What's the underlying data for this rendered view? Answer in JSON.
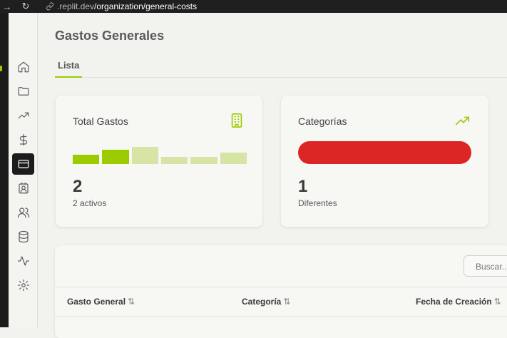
{
  "browser": {
    "url_host": ".replit.dev",
    "url_path": "/organization/general-costs",
    "forward_icon": "→",
    "reload_icon": "↻"
  },
  "sidebar": {
    "items": [
      {
        "name": "home-icon",
        "active": false
      },
      {
        "name": "folder-icon",
        "active": false
      },
      {
        "name": "trending-up-icon",
        "active": false
      },
      {
        "name": "dollar-icon",
        "active": false
      },
      {
        "name": "credit-card-icon",
        "active": true
      },
      {
        "name": "contact-badge-icon",
        "active": false
      },
      {
        "name": "users-icon",
        "active": false
      },
      {
        "name": "database-icon",
        "active": false
      },
      {
        "name": "activity-icon",
        "active": false
      },
      {
        "name": "settings-icon",
        "active": false
      }
    ]
  },
  "page": {
    "title": "Gastos Generales",
    "tabs": [
      "Lista"
    ]
  },
  "cards": {
    "total": {
      "label": "Total Gastos",
      "value": "2",
      "sub": "2 activos",
      "icon": "building-icon",
      "bar_levels": [
        0.55,
        0.85,
        1.0,
        0.4,
        0.4,
        0.65
      ],
      "bar_colors": [
        "#9ccc00",
        "#9ccc00",
        "#d6e4a6",
        "#d6e4a6",
        "#d6e4a6",
        "#d6e4a6"
      ]
    },
    "categories": {
      "label": "Categorías",
      "value": "1",
      "sub": "Diferentes",
      "icon": "trending-up-icon",
      "bar_color": "#dc2626"
    }
  },
  "table": {
    "search_placeholder": "Buscar...",
    "columns": [
      "Gasto General",
      "Categoría",
      "Fecha de Creación"
    ],
    "sort_icon": "⇅"
  },
  "colors": {
    "accent": "#9ccc00",
    "danger": "#dc2626",
    "sidebar_active": "#1c1c1c"
  }
}
